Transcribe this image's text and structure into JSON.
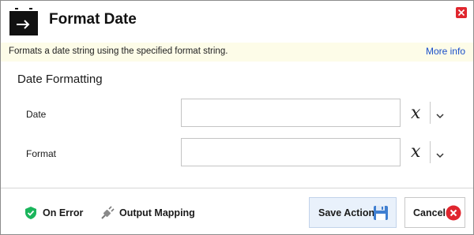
{
  "header": {
    "title": "Format Date",
    "icon": "calendar-arrow-icon",
    "close_icon": "close-icon"
  },
  "description": {
    "text": "Formats a date string using the specified format string.",
    "more_info": "More info"
  },
  "section": {
    "title": "Date Formatting"
  },
  "fields": [
    {
      "label": "Date",
      "value": "",
      "variable_icon": "variable-x-icon",
      "dropdown_icon": "chevron-down-icon"
    },
    {
      "label": "Format",
      "value": "",
      "variable_icon": "variable-x-icon",
      "dropdown_icon": "chevron-down-icon"
    }
  ],
  "footer": {
    "on_error": "On Error",
    "output_mapping": "Output Mapping",
    "save": "Save Action",
    "cancel": "Cancel"
  },
  "colors": {
    "accent_link": "#1a4fc9",
    "description_bg": "#fdfce8",
    "save_bg": "#e9f1fb",
    "close_red": "#e0262e",
    "shield_green": "#1bb55c",
    "floppy_blue": "#3f7fd1"
  }
}
